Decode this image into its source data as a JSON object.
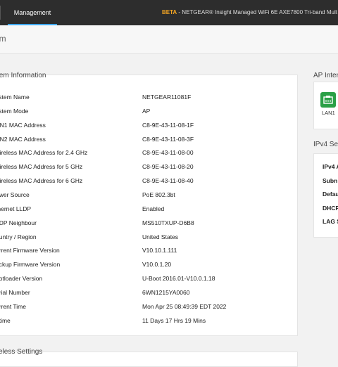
{
  "topbar": {
    "tab_management": "Management",
    "beta_tag": "BETA",
    "title_text": " - NETGEAR® Insight Managed WiFi 6E AXE7800 Tri-band Mult"
  },
  "page": {
    "title": "em"
  },
  "system_info": {
    "title": "tem Information",
    "rows": [
      {
        "label": "ystem Name",
        "value": "NETGEAR11081F"
      },
      {
        "label": "ystem Mode",
        "value": "AP"
      },
      {
        "label": "AN1 MAC Address",
        "value": "C8-9E-43-11-08-1F"
      },
      {
        "label": "AN2 MAC Address",
        "value": "C8-9E-43-11-08-3F"
      },
      {
        "label": "Vireless MAC Address for 2.4 GHz",
        "value": "C8-9E-43-11-08-00"
      },
      {
        "label": "Vireless MAC Address for 5 GHz",
        "value": "C8-9E-43-11-08-20"
      },
      {
        "label": "Vireless MAC Address for 6 GHz",
        "value": "C8-9E-43-11-08-40"
      },
      {
        "label": "ower Source",
        "value": "PoE 802.3bt"
      },
      {
        "label": "thernet LLDP",
        "value": "Enabled"
      },
      {
        "label": "LDP Neighbour",
        "value": "MS510TXUP-D6B8"
      },
      {
        "label": "ountry / Region",
        "value": "United States"
      },
      {
        "label": "urrent Firmware Version",
        "value": "V10.10.1.111"
      },
      {
        "label": "ackup Firmware Version",
        "value": "V10.0.1.20"
      },
      {
        "label": "ootloader Version",
        "value": "U-Boot 2016.01-V10.0.1.18"
      },
      {
        "label": "erial Number",
        "value": "6WN1215YA0060"
      },
      {
        "label": "urrent Time",
        "value": "Mon Apr 25 08:49:39 EDT 2022"
      },
      {
        "label": "ptime",
        "value": "11 Days 17 Hrs 19 Mins"
      }
    ]
  },
  "ap_interfaces": {
    "title": "AP Inter",
    "lan_label": "LAN1",
    "lan_color": "#2aa046"
  },
  "ipv4": {
    "title": "IPv4 Se",
    "rows": [
      "IPv4 A",
      "Subn",
      "Defau",
      "DHCP",
      "LAG S"
    ]
  },
  "wireless": {
    "title": "eless Settings"
  }
}
